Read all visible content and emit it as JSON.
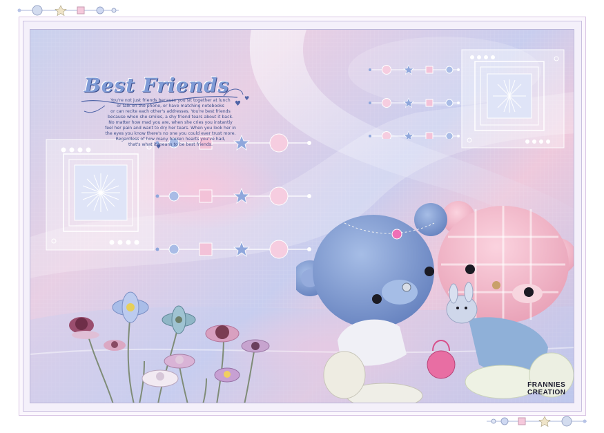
{
  "artwork": {
    "title": "Best Friends",
    "poem_lines": [
      "You're not just friends because you sit together at lunch",
      "or talk on the phone, or have matching notebooks",
      "or can recite each other's addresses. You're best friends",
      "because when she smiles, a shy friend tears about it back.",
      "No matter how mad you are, when she cries you instantly",
      "feel her pain and want to dry her tears. When you look her in",
      "the eyes you know there's no one you could ever trust more.",
      "Regardless of how many broken hearts you've had,",
      "that's what it means to be best friends."
    ],
    "signature_line1": "FRANNIES",
    "signature_line2": "CREATION"
  },
  "colors": {
    "border": "#d9c4e4",
    "bg_blue": "#c9d1ee",
    "bg_pink": "#eec9dc",
    "accent_blue": "#8fa7dc",
    "accent_pink": "#f3c2d8",
    "blue_bear": "#7f9ed4",
    "pink_bear": "#f1a9bf"
  }
}
